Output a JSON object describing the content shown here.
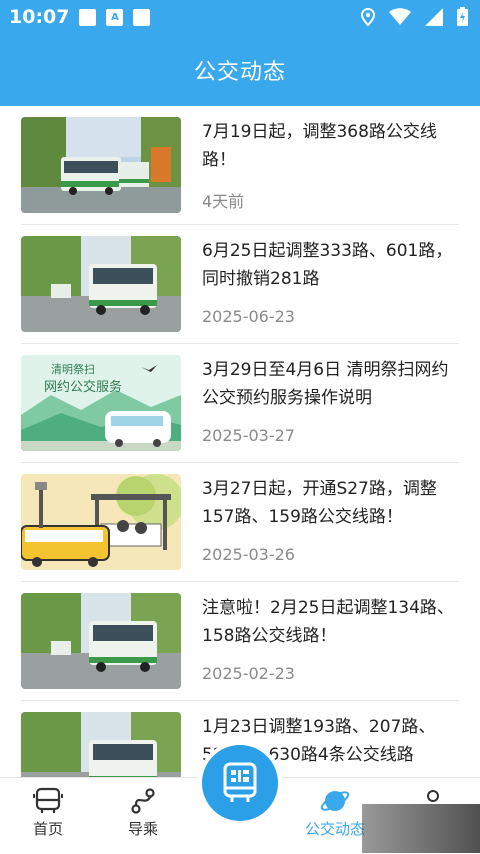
{
  "status_bar": {
    "time": "10:07",
    "notification_letter": "A"
  },
  "header": {
    "title": "公交动态"
  },
  "news": [
    {
      "title": "7月19日起，调整368路公交线路！",
      "date": "4天前"
    },
    {
      "title": "6月25日起调整333路、601路，同时撤销281路",
      "date": "2025-06-23"
    },
    {
      "title": " 3月29日至4月6日 清明祭扫网约公交预约服务操作说明",
      "date": "2025-03-27",
      "thumb_text_line1": "清明祭扫",
      "thumb_text_line2": "网约公交服务"
    },
    {
      "title": "3月27日起，开通S27路，调整157路、159路公交线路！",
      "date": "2025-03-26"
    },
    {
      "title": " 注意啦！2月25日起调整134路、158路公交线路！",
      "date": "2025-02-23"
    },
    {
      "title": "1月23日调整193路、207路、526路、630路4条公交线路",
      "date": ""
    }
  ],
  "tabbar": {
    "home": "首页",
    "guide": "导乘",
    "dynamics": "公交动态",
    "active_color": "#3aa8ec"
  },
  "colors": {
    "primary": "#3aa8ec"
  }
}
